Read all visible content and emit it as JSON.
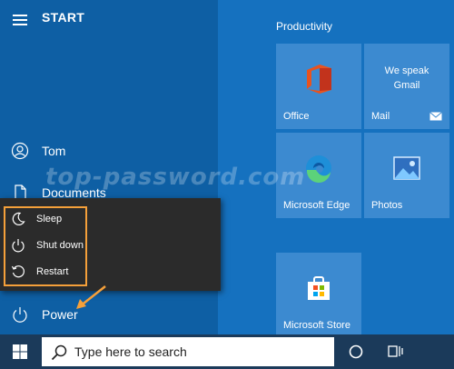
{
  "start_menu": {
    "title": "START",
    "nav": {
      "user": "Tom",
      "documents": "Documents",
      "power": "Power"
    },
    "power_menu": [
      {
        "label": "Sleep",
        "icon": "sleep-icon"
      },
      {
        "label": "Shut down",
        "icon": "shut-down-icon"
      },
      {
        "label": "Restart",
        "icon": "restart-icon"
      }
    ]
  },
  "tiles": {
    "section_title": "Productivity",
    "office": "Office",
    "mail": "Mail",
    "mail_promo_line1": "We speak",
    "mail_promo_line2": "Gmail",
    "edge": "Microsoft Edge",
    "photos": "Photos",
    "store": "Microsoft Store"
  },
  "watermark": "top-password.com",
  "taskbar": {
    "search_placeholder": "Type here to search"
  },
  "colors": {
    "highlight": "#f5a03a",
    "left_pane": "#0e5fa4",
    "tile_bg": "#3c8ad0"
  }
}
